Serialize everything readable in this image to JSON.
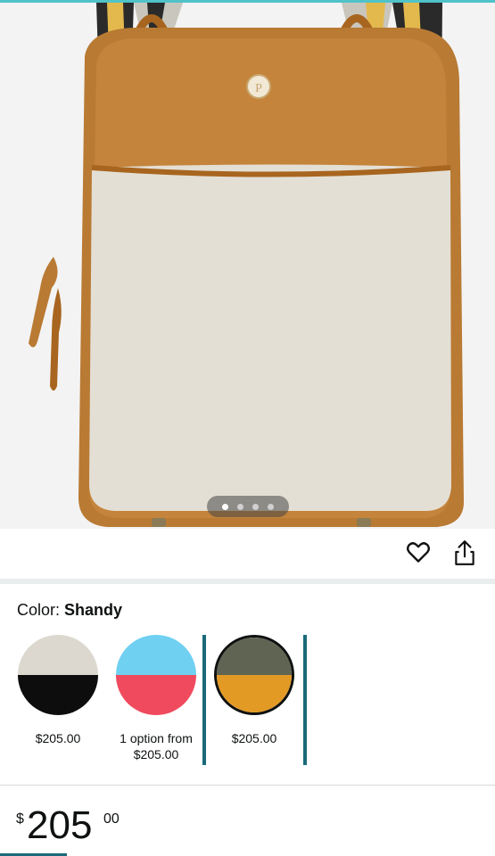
{
  "product": {
    "pager": {
      "total": 4,
      "active_index": 0
    }
  },
  "color_selector": {
    "label": "Color:",
    "selected": "Shandy",
    "options": [
      {
        "top_color": "#dcd8d0",
        "bottom_color": "#0d0d0d",
        "price_line1": "$205.00",
        "price_line2": ""
      },
      {
        "top_color": "#6fd0f2",
        "bottom_color": "#f04a5e",
        "price_line1": "1 option from",
        "price_line2": "$205.00"
      },
      {
        "top_color": "#5f6453",
        "bottom_color": "#e39a25",
        "price_line1": "$205.00",
        "price_line2": "",
        "selected": true
      }
    ]
  },
  "price": {
    "currency": "$",
    "whole": "205",
    "fraction": "00"
  },
  "icons": {
    "favorite": "heart-outline-icon",
    "share": "share-icon"
  }
}
